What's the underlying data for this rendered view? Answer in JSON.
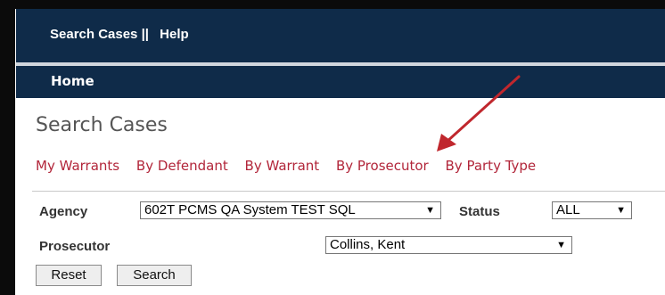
{
  "header": {
    "nav_search": "Search Cases ||",
    "nav_help": "Help",
    "home": "Home"
  },
  "page": {
    "title": "Search Cases"
  },
  "tabs": [
    "My Warrants",
    "By Defendant",
    "By Warrant",
    "By Prosecutor",
    "By Party Type"
  ],
  "form": {
    "agency_label": "Agency",
    "agency_value": "602T PCMS QA System TEST SQL",
    "status_label": "Status",
    "status_value": "ALL",
    "prosecutor_label": "Prosecutor",
    "prosecutor_value": "Collins, Kent",
    "reset_label": "Reset",
    "search_label": "Search"
  },
  "colors": {
    "header_bg": "#0f2b49",
    "tab_link": "#b2263a",
    "annotation_arrow": "#c0272d"
  },
  "icons": {
    "dropdown": "chevron-down-icon",
    "annotation": "red-arrow-icon"
  }
}
